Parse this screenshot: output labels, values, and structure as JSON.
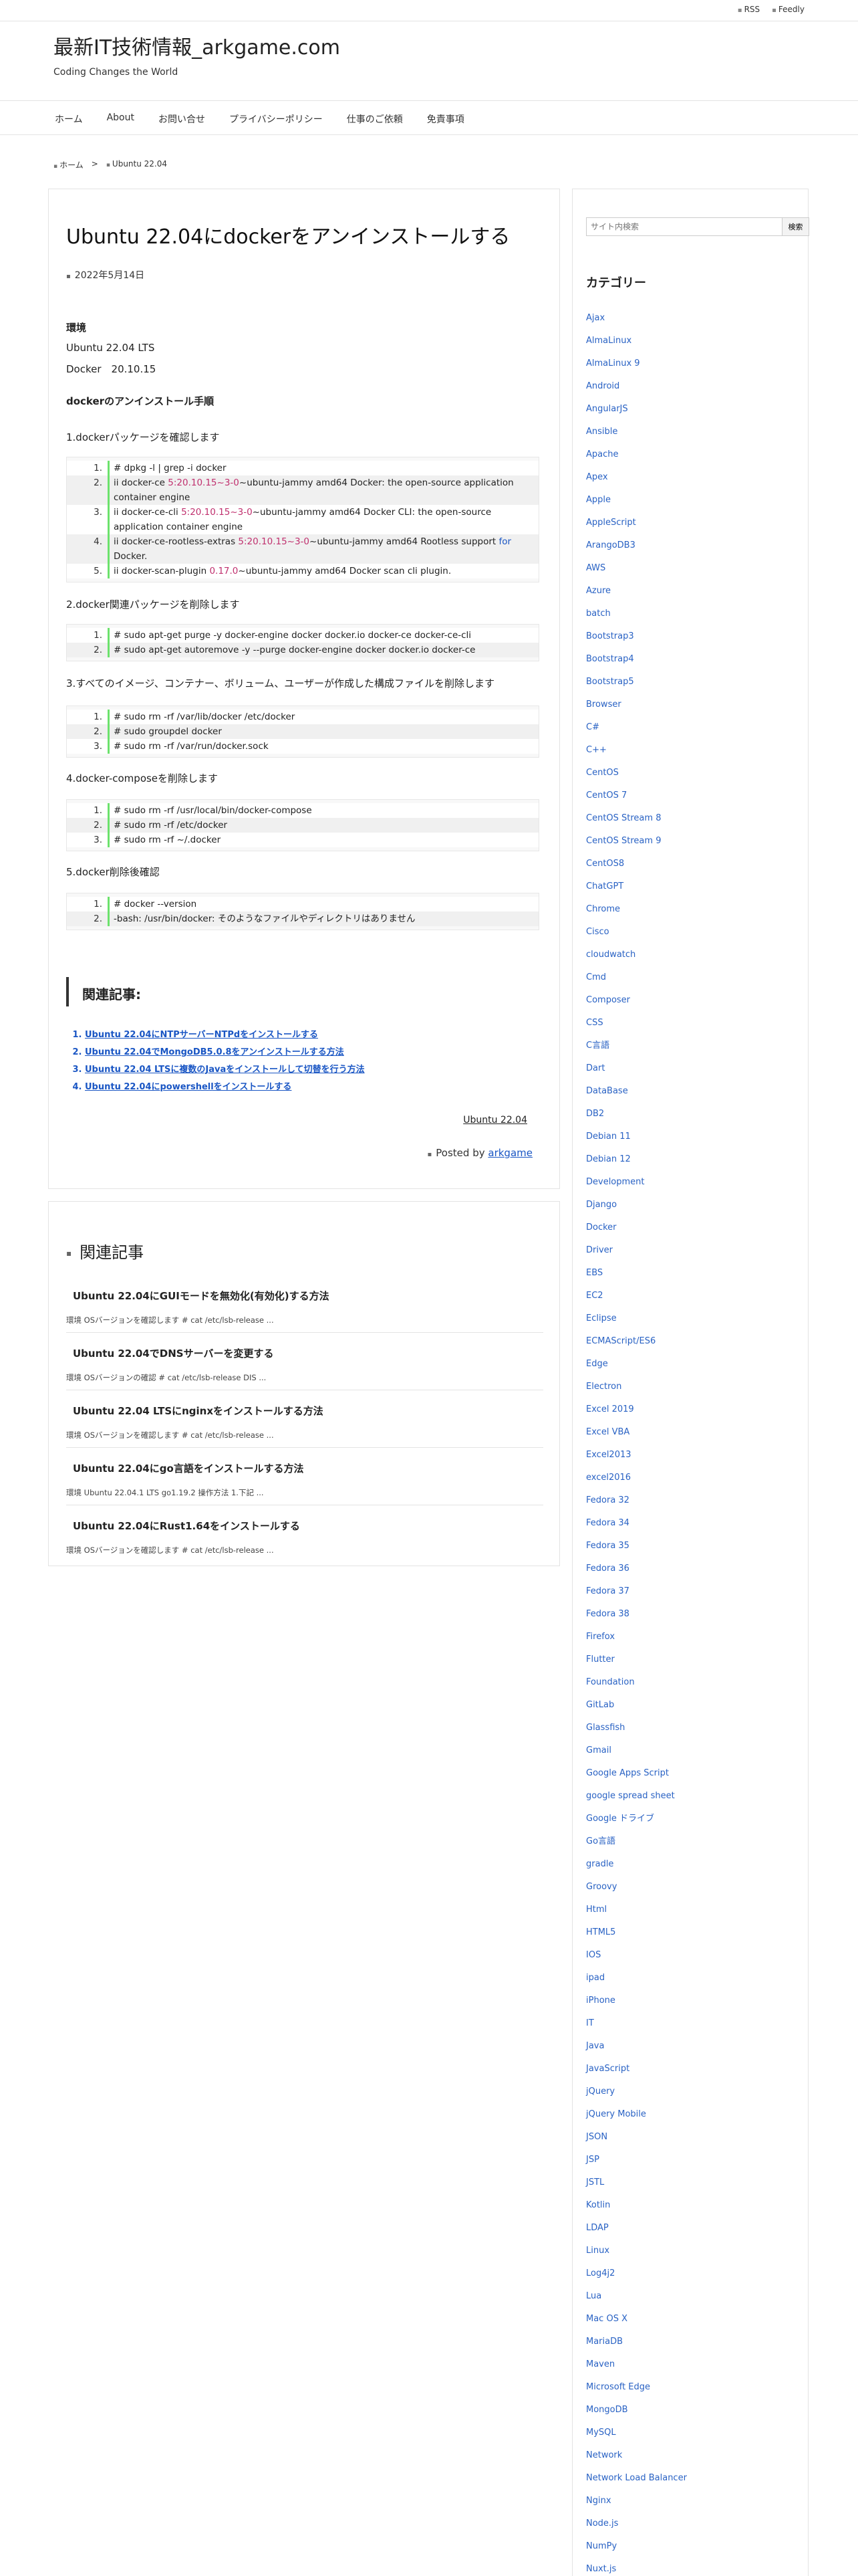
{
  "header": {
    "rss": "RSS",
    "feedly": "Feedly",
    "site_title": "最新IT技術情報_arkgame.com",
    "site_desc": "Coding Changes the World"
  },
  "nav": [
    "ホーム",
    "About",
    "お問い合せ",
    "プライバシーポリシー",
    "仕事のご依頼",
    "免責事項"
  ],
  "breadcrumb": {
    "home": "ホーム",
    "sep": ">",
    "current": "Ubuntu 22.04"
  },
  "post": {
    "title": "Ubuntu 22.04にdockerをアンインストールする",
    "date": "2022年5月14日",
    "env_heading": "環境",
    "env_os": "Ubuntu 22.04 LTS",
    "env_docker": "Docker　20.10.15",
    "steps_heading": "dockerのアンインストール手順",
    "step1": "1.dockerパッケージを確認します",
    "step2": "2.docker関連パッケージを削除します",
    "step3": "3.すべてのイメージ、コンテナー、ボリューム、ユーザーが作成した構成ファイルを削除します",
    "step4": "4.docker-composeを削除します",
    "step5": "5.docker削除後確認",
    "code1": {
      "l1": "# dpkg -l | grep -i docker",
      "l2a": "ii docker-ce ",
      "l2b": "5:20.10.15~3-0",
      "l2c": "~ubuntu-jammy amd64 Docker: the open-source application",
      "l2d": "container engine",
      "l3a": "ii docker-ce-cli ",
      "l3b": "5:20.10.15~3-0",
      "l3c": "~ubuntu-jammy amd64 Docker CLI: the open-source",
      "l3d": "application container engine",
      "l4a": "ii docker-ce-rootless-extras ",
      "l4b": "5:20.10.15~3-0",
      "l4c": "~ubuntu-jammy amd64 Rootless support ",
      "l4d": "for",
      "l4e": "Docker.",
      "l5a": "ii docker-scan-plugin ",
      "l5b": "0.17.0",
      "l5c": "~ubuntu-jammy amd64 Docker scan cli plugin."
    },
    "code2": [
      "# sudo apt-get purge -y docker-engine docker docker.io docker-ce docker-ce-cli",
      "# sudo apt-get autoremove -y --purge docker-engine docker docker.io docker-ce"
    ],
    "code3": [
      "# sudo rm -rf /var/lib/docker /etc/docker",
      "# sudo groupdel docker",
      "# sudo rm -rf /var/run/docker.sock"
    ],
    "code4": [
      "# sudo rm -rf /usr/local/bin/docker-compose",
      "# sudo rm -rf /etc/docker",
      "# sudo rm -rf ~/.docker"
    ],
    "code5": [
      "# docker --version",
      "-bash: /usr/bin/docker: そのようなファイルやディレクトリはありません"
    ],
    "related_heading": "関連記事:",
    "related_links": [
      "Ubuntu 22.04にNTPサーバーNTPdをインストールする",
      "Ubuntu 22.04でMongoDB5.0.8をアンインストールする方法",
      "Ubuntu 22.04 LTSに複数のJavaをインストールして切替を行う方法",
      "Ubuntu 22.04にpowershellをインストールする"
    ],
    "tag": "Ubuntu 22.04",
    "posted_by": "Posted by",
    "author": "arkgame"
  },
  "related": {
    "heading": "関連記事",
    "items": [
      {
        "title": "Ubuntu 22.04にGUIモードを無効化(有効化)する方法",
        "snippet": "環境 OSバージョンを確認します # cat /etc/lsb-release ..."
      },
      {
        "title": "Ubuntu 22.04でDNSサーバーを変更する",
        "snippet": "環境 OSバージョンの確認 # cat /etc/lsb-release DIS ..."
      },
      {
        "title": "Ubuntu 22.04 LTSにnginxをインストールする方法",
        "snippet": "環境 OSバージョンを確認します # cat /etc/lsb-release ..."
      },
      {
        "title": "Ubuntu 22.04にgo言語をインストールする方法",
        "snippet": "環境 Ubuntu 22.04.1 LTS go1.19.2 操作方法 1.下記 ..."
      },
      {
        "title": "Ubuntu 22.04にRust1.64をインストールする",
        "snippet": "環境 OSバージョンを確認します # cat /etc/lsb-release ..."
      }
    ]
  },
  "sidebar": {
    "search_placeholder": "サイト内検索",
    "search_button": "検索",
    "categories_heading": "カテゴリー",
    "categories": [
      "Ajax",
      "AlmaLinux",
      "AlmaLinux 9",
      "Android",
      "AngularJS",
      "Ansible",
      "Apache",
      "Apex",
      "Apple",
      "AppleScript",
      "ArangoDB3",
      "AWS",
      "Azure",
      "batch",
      "Bootstrap3",
      "Bootstrap4",
      "Bootstrap5",
      "Browser",
      "C#",
      "C++",
      "CentOS",
      "CentOS 7",
      "CentOS Stream 8",
      "CentOS Stream 9",
      "CentOS8",
      "ChatGPT",
      "Chrome",
      "Cisco",
      "cloudwatch",
      "Cmd",
      "Composer",
      "CSS",
      "C言語",
      "Dart",
      "DataBase",
      "DB2",
      "Debian 11",
      "Debian 12",
      "Development",
      "Django",
      "Docker",
      "Driver",
      "EBS",
      "EC2",
      "Eclipse",
      "ECMAScript/ES6",
      "Edge",
      "Electron",
      "Excel 2019",
      "Excel VBA",
      "Excel2013",
      "excel2016",
      "Fedora 32",
      "Fedora 34",
      "Fedora 35",
      "Fedora 36",
      "Fedora 37",
      "Fedora 38",
      "Firefox",
      "Flutter",
      "Foundation",
      "GitLab",
      "Glassfish",
      "Gmail",
      "Google Apps Script",
      "google spread sheet",
      "Google ドライブ",
      "Go言語",
      "gradle",
      "Groovy",
      "Html",
      "HTML5",
      "IOS",
      "ipad",
      "iPhone",
      "IT",
      "Java",
      "JavaScript",
      "jQuery",
      "jQuery Mobile",
      "JSON",
      "JSP",
      "JSTL",
      "Kotlin",
      "LDAP",
      "Linux",
      "Log4j2",
      "Lua",
      "Mac OS X",
      "MariaDB",
      "Maven",
      "Microsoft Edge",
      "MongoDB",
      "MySQL",
      "Network",
      "Network Load Balancer",
      "Nginx",
      "Node.js",
      "NumPy",
      "Nuxt.js"
    ]
  }
}
